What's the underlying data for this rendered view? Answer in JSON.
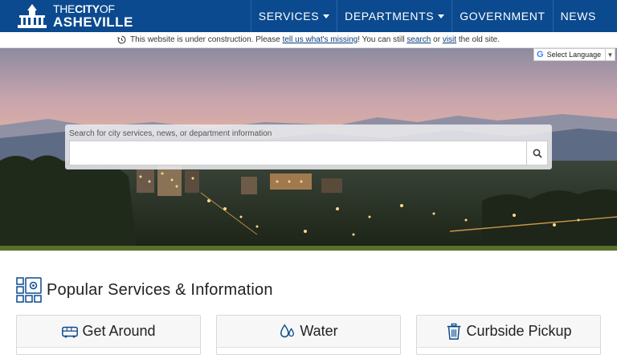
{
  "header": {
    "logo_line1_pre": "THE",
    "logo_line1_bold": "CITY",
    "logo_line1_post": "OF",
    "logo_line2": "ASHEVILLE",
    "nav": [
      {
        "label": "SERVICES",
        "dropdown": true
      },
      {
        "label": "DEPARTMENTS",
        "dropdown": true
      },
      {
        "label": "GOVERNMENT",
        "dropdown": false
      },
      {
        "label": "NEWS",
        "dropdown": false
      }
    ]
  },
  "notice": {
    "t1": "This website is under construction. Please ",
    "link1": "tell us what's missing",
    "t2": "! You can still ",
    "link2": "search",
    "t3": " or ",
    "link3": "visit",
    "t4": " the old site."
  },
  "translate": {
    "label": "Select Language",
    "arrow": "▼"
  },
  "search": {
    "label": "Search for city services, news, or department information",
    "value": "",
    "icon": "search-icon"
  },
  "content": {
    "section_title": "Popular Services & Information",
    "cards": [
      {
        "label": "Get Around",
        "icon": "bus-icon"
      },
      {
        "label": "Water",
        "icon": "water-drops-icon"
      },
      {
        "label": "Curbside Pickup",
        "icon": "trash-can-icon"
      }
    ]
  },
  "colors": {
    "header_bg": "#0b4a8f",
    "accent_strip": "#5a6f2a",
    "icon_blue": "#0b4a8f"
  }
}
